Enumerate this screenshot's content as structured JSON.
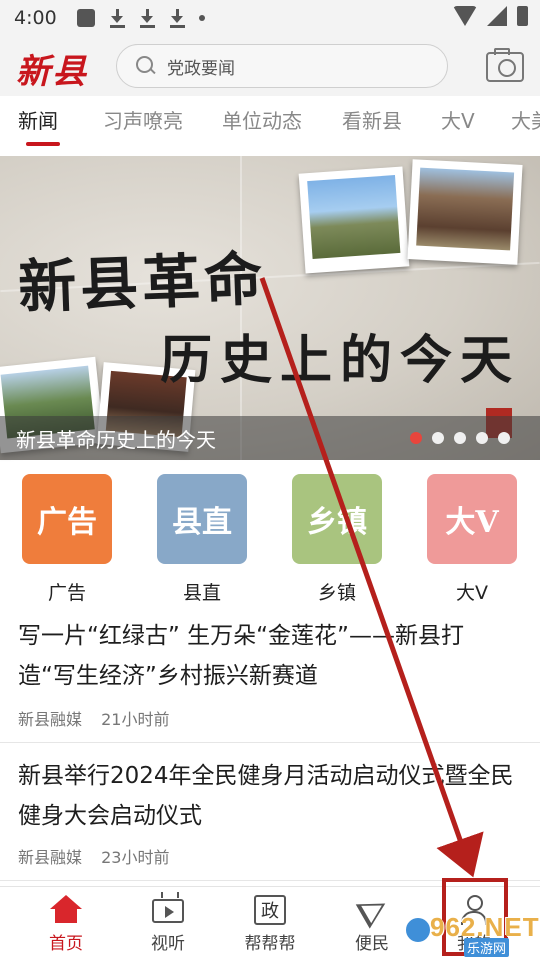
{
  "status_bar": {
    "time": "4:00"
  },
  "header": {
    "logo": "新县",
    "search_placeholder": "党政要闻"
  },
  "tabs": [
    {
      "label": "新闻",
      "active": true
    },
    {
      "label": "习声嘹亮"
    },
    {
      "label": "单位动态"
    },
    {
      "label": "看新县"
    },
    {
      "label": "大V"
    },
    {
      "label": "大美"
    }
  ],
  "banner": {
    "title_line1": "新县革命",
    "title_line2": "历史上的今天",
    "caption": "新县革命历史上的今天",
    "slide_count": 5,
    "active_slide": 1
  },
  "categories": [
    {
      "tile": "广告",
      "label": "广告",
      "color": "#ef7d3c"
    },
    {
      "tile": "县直",
      "label": "县直",
      "color": "#88a8c8"
    },
    {
      "tile": "乡镇",
      "label": "乡镇",
      "color": "#a9c47f"
    },
    {
      "tile": "大V",
      "label": "大V",
      "color": "#ef9a99"
    }
  ],
  "articles": [
    {
      "title": "写一片“红绿古” 生万朵“金莲花”——新县打造“写生经济”乡村振兴新赛道",
      "source": "新县融媒",
      "time": "21小时前"
    },
    {
      "title": "新县举行2024年全民健身月活动启动仪式暨全民健身大会启动仪式",
      "source": "新县融媒",
      "time": "23小时前"
    }
  ],
  "bottom_nav": [
    {
      "label": "首页",
      "icon": "home-icon",
      "active": true
    },
    {
      "label": "视听",
      "icon": "tv-icon"
    },
    {
      "label": "帮帮帮",
      "icon": "zheng-icon",
      "glyph": "政"
    },
    {
      "label": "便民",
      "icon": "send-icon"
    },
    {
      "label": "我的",
      "icon": "person-icon"
    }
  ],
  "watermark": {
    "main": "962.NET",
    "sub": "乐游网"
  },
  "colors": {
    "brand_red": "#c8161d",
    "annotation_red": "#b5201c"
  }
}
